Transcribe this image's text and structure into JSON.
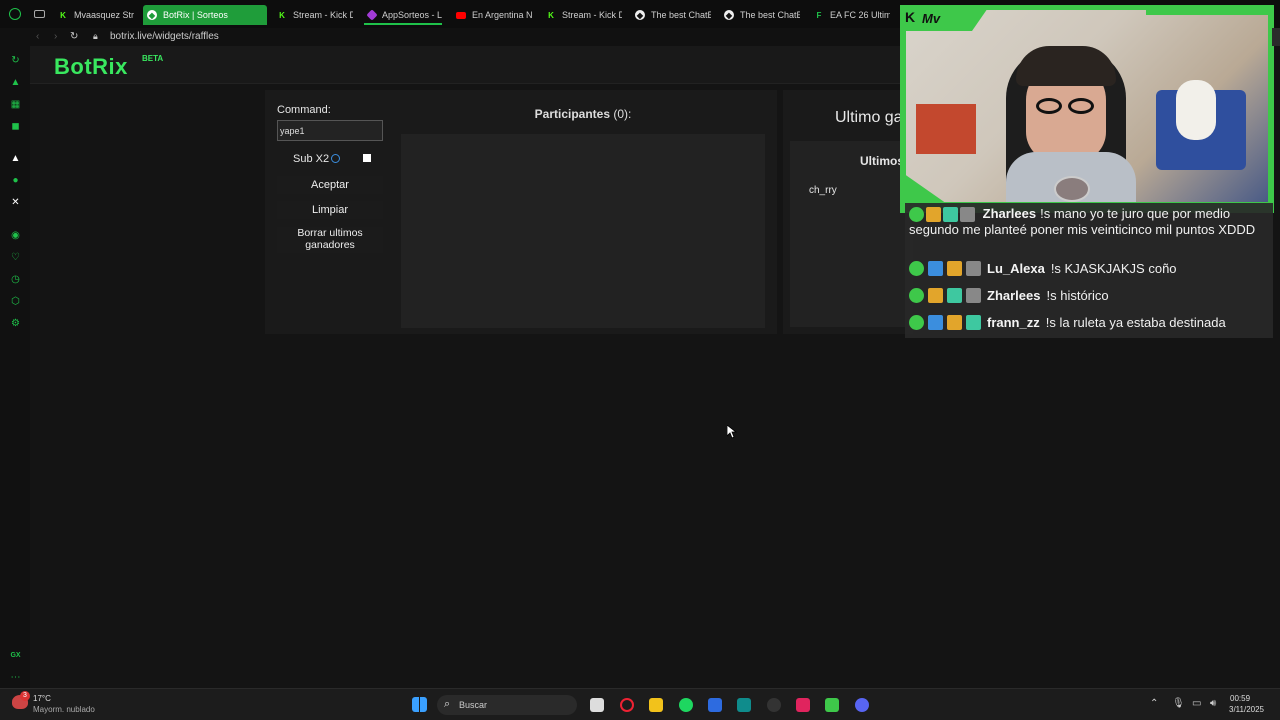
{
  "tabs": [
    {
      "label": "Mvaasquez Str",
      "icon": "kick-icon"
    },
    {
      "label": "BotRix | Sorteos",
      "icon": "botrix-icon"
    },
    {
      "label": "Stream - Kick D",
      "icon": "kick-icon"
    },
    {
      "label": "AppSorteos - L",
      "icon": "appsorteos-icon"
    },
    {
      "label": "En Argentina N",
      "icon": "youtube-icon"
    },
    {
      "label": "Stream - Kick D",
      "icon": "kick-icon"
    },
    {
      "label": "The best ChatB",
      "icon": "chatb-icon"
    },
    {
      "label": "The best ChatB",
      "icon": "chatb-icon"
    },
    {
      "label": "EA FC 26 Ultim",
      "icon": "ea-icon"
    }
  ],
  "address": "botrix.live/widgets/raffles",
  "brand": {
    "name": "BotRix",
    "tag": "BETA"
  },
  "raffle": {
    "command_label": "Command:",
    "command_value": "yape1",
    "sub_label": "Sub X2",
    "accept": "Aceptar",
    "clear": "Limpiar",
    "delete_winners": "Borrar ultimos ganadores",
    "participants_label": "Participantes",
    "participants_count": "(0):",
    "last_winner_title": "Ultimo ga",
    "last_list_title": "Ultimos",
    "last_winner_name": "ch_rry"
  },
  "overlay": {
    "channel_tag": "Mv",
    "messages": [
      {
        "user": "Zharlees",
        "text": "!s mano yo te juro que por medio segundo me planteé poner mis veinticinco mil puntos XDDD"
      },
      {
        "user": "Lu_Alexa",
        "text": "!s KJASKJAKJS coño"
      },
      {
        "user": "Zharlees",
        "text": "!s histórico"
      },
      {
        "user": "frann_zz",
        "text": "!s la ruleta ya estaba destinada"
      }
    ]
  },
  "taskbar": {
    "weather_temp": "17°C",
    "weather_desc": "Mayorm. nublado",
    "search_placeholder": "Buscar",
    "time": "00:59",
    "date": "3/11/2025",
    "notif_count": "3"
  },
  "colors": {
    "accent": "#39e75f",
    "brand_green": "#1f9d3a"
  }
}
